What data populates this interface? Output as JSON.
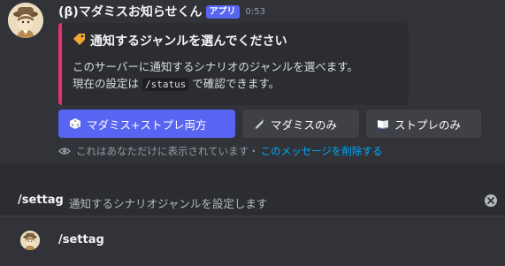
{
  "message": {
    "bot_name": "(β)マダミスお知らせくん",
    "badge": "アプリ",
    "time": "0:53",
    "embed": {
      "accent_color": "#e8306f",
      "title_icon": "label-tag-icon",
      "title": "通知するジャンルを選んでください",
      "desc_line1": "このサーバーに通知するシナリオのジャンルを選べます。",
      "desc_line2_prefix": "現在の設定は ",
      "desc_line2_code": "/status",
      "desc_line2_suffix": " で確認できます。"
    },
    "buttons": [
      {
        "label": "マダミス+ストプレ両方",
        "icon": "game-die-icon",
        "style": "primary"
      },
      {
        "label": "マダミスのみ",
        "icon": "knife-icon",
        "style": "secondary"
      },
      {
        "label": "ストプレのみ",
        "icon": "open-book-icon",
        "style": "secondary"
      }
    ],
    "ephemeral": {
      "text": "これはあなただけに表示されています・",
      "link": "このメッセージを削除する"
    }
  },
  "command_panel": {
    "command": "/settag",
    "description": "通知するシナリオジャンルを設定します",
    "option_label": "/settag"
  },
  "colors": {
    "blurple": "#5865f2",
    "link": "#00a8fc",
    "background": "#313338",
    "embed_bg": "#2b2d31"
  }
}
